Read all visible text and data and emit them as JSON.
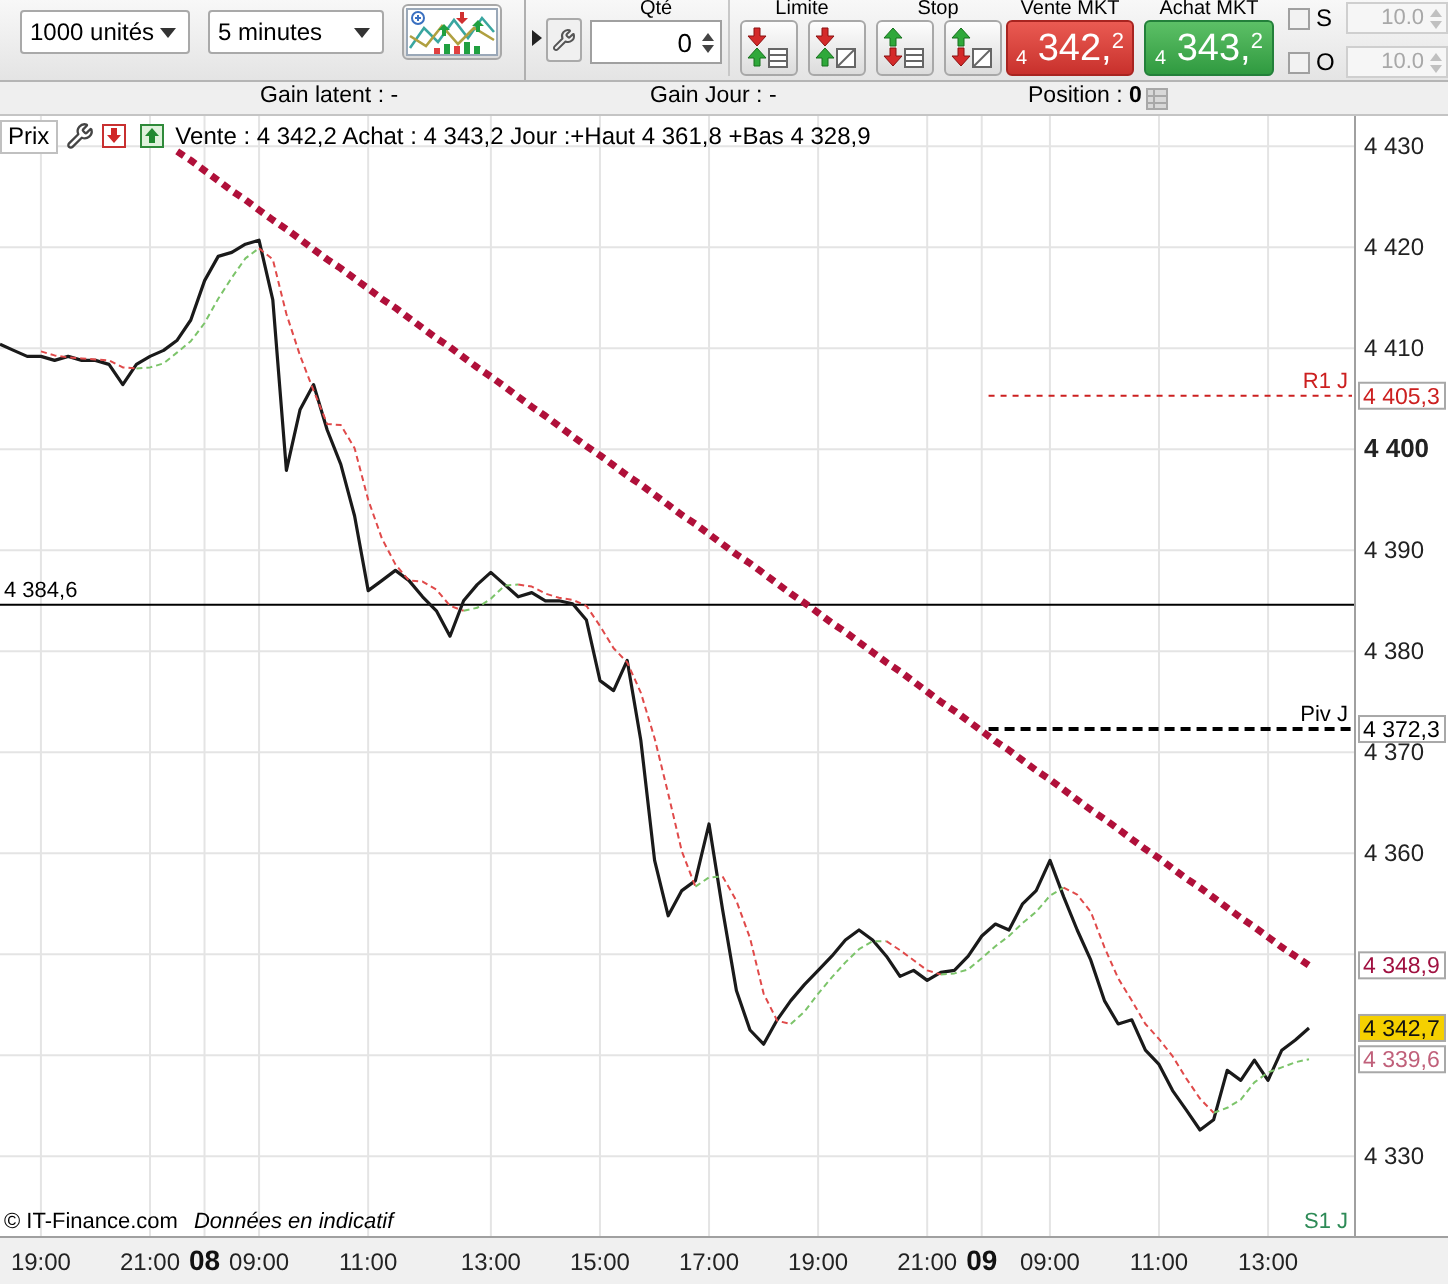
{
  "toolbar": {
    "dropdowns": [
      {
        "kind": "units",
        "value": "1000 unités"
      },
      {
        "kind": "interval",
        "value": "5 minutes"
      }
    ],
    "quantity": {
      "label": "Qté",
      "value": "0"
    },
    "order_groups": [
      {
        "kind": "limit",
        "label": "Limite",
        "buttons": [
          {
            "kind": "list"
          },
          {
            "kind": "slash"
          }
        ]
      },
      {
        "kind": "stop",
        "label": "Stop",
        "buttons": [
          {
            "kind": "list"
          },
          {
            "kind": "slash"
          }
        ]
      }
    ],
    "market_orders": [
      {
        "kind": "sell",
        "label": "Vente MKT",
        "price": "$_{4}$ 342,$^{2}$"
      },
      {
        "kind": "buy",
        "label": "Achat MKT",
        "price": "$_{4}$ 343,$^{2}$"
      }
    ],
    "options": [
      {
        "label": "S",
        "checked": false,
        "value": "10.0",
        "disabled": true
      },
      {
        "label": "O",
        "checked": false,
        "value": "10.0",
        "disabled": true
      }
    ]
  },
  "info_bar": {
    "gain_latent": "Gain latent : -",
    "gain_day": "Gain Jour : -",
    "position": "Position : **0**"
  },
  "chart": {
    "series_label": "Prix",
    "summary": "Vente : 4 342,2 Achat : 4 343,2 Jour :+Haut 4 361,8 +Bas 4 328,9",
    "copyright": "© IT-Finance.com",
    "disclaimer": "Données en indicatif",
    "day_labels": [
      "08",
      "09"
    ],
    "chart_data": {
      "type": "line",
      "categories": [
        null,
        null,
        null,
        "19:00",
        null,
        null,
        null,
        null,
        null,
        null,
        null,
        "21:00",
        null,
        null,
        null,
        null,
        null,
        null,
        null,
        "09:00",
        null,
        null,
        null,
        null,
        null,
        null,
        null,
        "11:00",
        null,
        null,
        null,
        null,
        null,
        null,
        null,
        null,
        "13:00",
        null,
        null,
        null,
        null,
        null,
        null,
        null,
        "15:00",
        null,
        null,
        null,
        null,
        null,
        null,
        null,
        "17:00",
        null,
        null,
        null,
        null,
        null,
        null,
        null,
        "19:00",
        null,
        null,
        null,
        null,
        null,
        null,
        null,
        "21:00",
        null,
        null,
        null,
        null,
        null,
        null,
        null,
        null,
        "09:00",
        null,
        null,
        null,
        null,
        null,
        null,
        null,
        "11:00",
        null,
        null,
        null,
        null,
        null,
        null,
        null,
        "13:00",
        null,
        null,
        null
      ],
      "series": [
        {
          "color": "#1a1a1a",
          "line_style": "solid",
          "values": [
            4410.4,
            4409.8,
            4409.2,
            4409.2,
            4408.8,
            4409.2,
            4408.8,
            4408.8,
            4408.4,
            4406.4,
            4408.4,
            4409.2,
            4409.8,
            4410.8,
            4412.8,
            4416.7,
            4419.1,
            4419.5,
            4420.3,
            4420.7,
            4414.8,
            4397.9,
            4403.9,
            4406.4,
            4401.9,
            4398.5,
            4393.4,
            4386.0,
            4387.0,
            4388.0,
            4387.0,
            4385.4,
            4384.0,
            4381.5,
            4385.0,
            4386.6,
            4387.8,
            4386.6,
            4385.4,
            4385.8,
            4385.0,
            4385.0,
            4384.7,
            4383.1,
            4377.1,
            4376.1,
            4379.1,
            4371.2,
            4359.3,
            4353.8,
            4356.3,
            4357.3,
            4362.9,
            4354.4,
            4346.4,
            4342.5,
            4341.1,
            4343.5,
            4345.4,
            4347.0,
            4348.4,
            4349.8,
            4351.4,
            4352.4,
            4351.4,
            4349.8,
            4347.8,
            4348.4,
            4347.4,
            4348.2,
            4348.4,
            4349.8,
            4351.8,
            4353.0,
            4352.4,
            4355.0,
            4356.3,
            4359.3,
            4355.7,
            4352.4,
            4349.4,
            4345.4,
            4343.1,
            4343.5,
            4340.5,
            4339.1,
            4336.5,
            4334.6,
            4332.6,
            4333.6,
            4338.5,
            4337.5,
            4339.5,
            4337.5,
            4340.5,
            4341.5,
            4342.7
          ]
        },
        {
          "color": "#b0103a",
          "line_style": "dashed",
          "values": [
            null,
            null,
            null,
            null,
            null,
            null,
            null,
            null,
            null,
            null,
            null,
            null,
            null,
            4429.5,
            4428.6,
            4427.6,
            4426.6,
            4425.6,
            4424.7,
            4423.7,
            4422.7,
            4421.8,
            4420.8,
            4419.8,
            4418.8,
            4417.9,
            4416.9,
            4415.9,
            4414.9,
            4414.0,
            4413.0,
            4412.0,
            4411.0,
            4410.1,
            4409.1,
            4408.1,
            4407.2,
            4406.2,
            4405.2,
            4404.2,
            4403.3,
            4402.3,
            4401.3,
            4400.3,
            4399.4,
            4398.4,
            4397.4,
            4396.5,
            4395.5,
            4394.5,
            4393.5,
            4392.6,
            4391.6,
            4390.6,
            4389.6,
            4388.7,
            4387.7,
            4386.7,
            4385.7,
            4384.8,
            4383.8,
            4382.8,
            4381.9,
            4380.9,
            4379.9,
            4378.9,
            4378.0,
            4377.0,
            4376.0,
            4375.0,
            4374.1,
            4373.1,
            4372.1,
            4371.1,
            4370.2,
            4369.2,
            4368.2,
            4367.3,
            4366.3,
            4365.3,
            4364.3,
            4363.4,
            4362.4,
            4361.4,
            4360.4,
            4359.5,
            4358.5,
            4357.5,
            4356.6,
            4355.6,
            4354.6,
            4353.6,
            4352.7,
            4351.7,
            4350.7,
            4349.8,
            4348.9
          ]
        },
        {
          "color": "#7cc46a",
          "line_style": "dashed",
          "values": [
            null,
            null,
            null,
            null,
            null,
            null,
            null,
            null,
            null,
            null,
            4408.0,
            4408.1,
            4408.5,
            4409.6,
            4410.7,
            4412.5,
            4414.9,
            4417.0,
            4418.9,
            4419.9,
            null,
            null,
            null,
            null,
            null,
            null,
            null,
            null,
            null,
            null,
            null,
            null,
            null,
            null,
            4384.0,
            4384.3,
            4385.2,
            4386.5,
            4386.6,
            null,
            null,
            null,
            null,
            null,
            null,
            null,
            null,
            null,
            null,
            null,
            null,
            4356.7,
            4357.6,
            4357.7,
            null,
            null,
            null,
            null,
            4343.1,
            4344.3,
            4346.1,
            4347.7,
            4349.2,
            4350.5,
            4351.3,
            4351.3,
            null,
            null,
            null,
            4348.0,
            4348.1,
            4348.5,
            4349.6,
            4350.8,
            4351.8,
            4353.1,
            4354.2,
            4355.8,
            4356.6,
            null,
            null,
            null,
            null,
            null,
            null,
            null,
            null,
            null,
            null,
            4334.3,
            4334.8,
            4335.6,
            4337.3,
            4338.3,
            4338.8,
            4339.3,
            4339.6
          ]
        },
        {
          "color": "#e04a4a",
          "line_style": "dashed",
          "values": [
            null,
            null,
            null,
            4409.7,
            4409.3,
            4409.1,
            4409.0,
            4408.9,
            4408.8,
            4408.1,
            4408.0,
            null,
            null,
            null,
            null,
            null,
            null,
            null,
            null,
            4419.9,
            4418.8,
            4413.4,
            4409.3,
            4405.8,
            4402.5,
            4402.4,
            4400.1,
            4395.0,
            4391.2,
            4388.6,
            4387.0,
            4386.9,
            4386.1,
            4384.5,
            4384.0,
            null,
            null,
            null,
            4386.6,
            4386.4,
            4385.7,
            4385.3,
            4385.1,
            4384.5,
            4382.5,
            4380.3,
            4378.9,
            4375.9,
            4371.4,
            4365.9,
            4360.2,
            4356.7,
            null,
            4357.7,
            4355.3,
            4351.6,
            4346.1,
            4343.4,
            4343.1,
            null,
            null,
            null,
            null,
            null,
            null,
            4351.3,
            4350.4,
            4349.4,
            4348.4,
            4348.0,
            null,
            null,
            null,
            null,
            null,
            null,
            null,
            null,
            4356.6,
            4355.9,
            4354.2,
            4350.7,
            4347.6,
            4345.4,
            4343.1,
            4341.6,
            4339.9,
            4337.7,
            4335.7,
            4334.3,
            null,
            null,
            null,
            null,
            null,
            null,
            null
          ]
        }
      ],
      "ylim": [
        4322.1,
        4433
      ],
      "grid": true,
      "yticks": [
        {
          "value": 4330,
          "label": "4 330"
        },
        {
          "value": 4360,
          "label": "4 360"
        },
        {
          "value": 4370,
          "label": "4 370"
        },
        {
          "value": 4380,
          "label": "4 380"
        },
        {
          "value": 4390,
          "label": "4 390"
        },
        {
          "value": 4400,
          "label": "4 400"
        },
        {
          "value": 4410,
          "label": "4 410"
        },
        {
          "value": 4420,
          "label": "4 420"
        },
        {
          "value": 4430,
          "label": "4 430"
        }
      ],
      "ref_lines": [
        {
          "axis": "y",
          "value": 4384.6,
          "label": "4 384,6",
          "color": "#000000"
        },
        {
          "axis": "y",
          "value": 4405.3,
          "label": "R1 J",
          "color": "#cc2020"
        },
        {
          "axis": "y",
          "value": 4372.3,
          "label": "Piv J",
          "color": "#000000"
        }
      ],
      "annotations": [
        "S1 J"
      ]
    },
    "price_tags": [
      {
        "kind": "level",
        "text": "4 405,3",
        "color": "#cc2020"
      },
      {
        "kind": "level",
        "text": "4 372,3",
        "color": "#000000"
      },
      {
        "kind": "long_average",
        "text": "4 348,9",
        "color": "#a01040"
      },
      {
        "kind": "price",
        "text": "4 342,7"
      },
      {
        "kind": "short_average",
        "text": "4 339,6",
        "color": "#c0607a"
      }
    ]
  }
}
